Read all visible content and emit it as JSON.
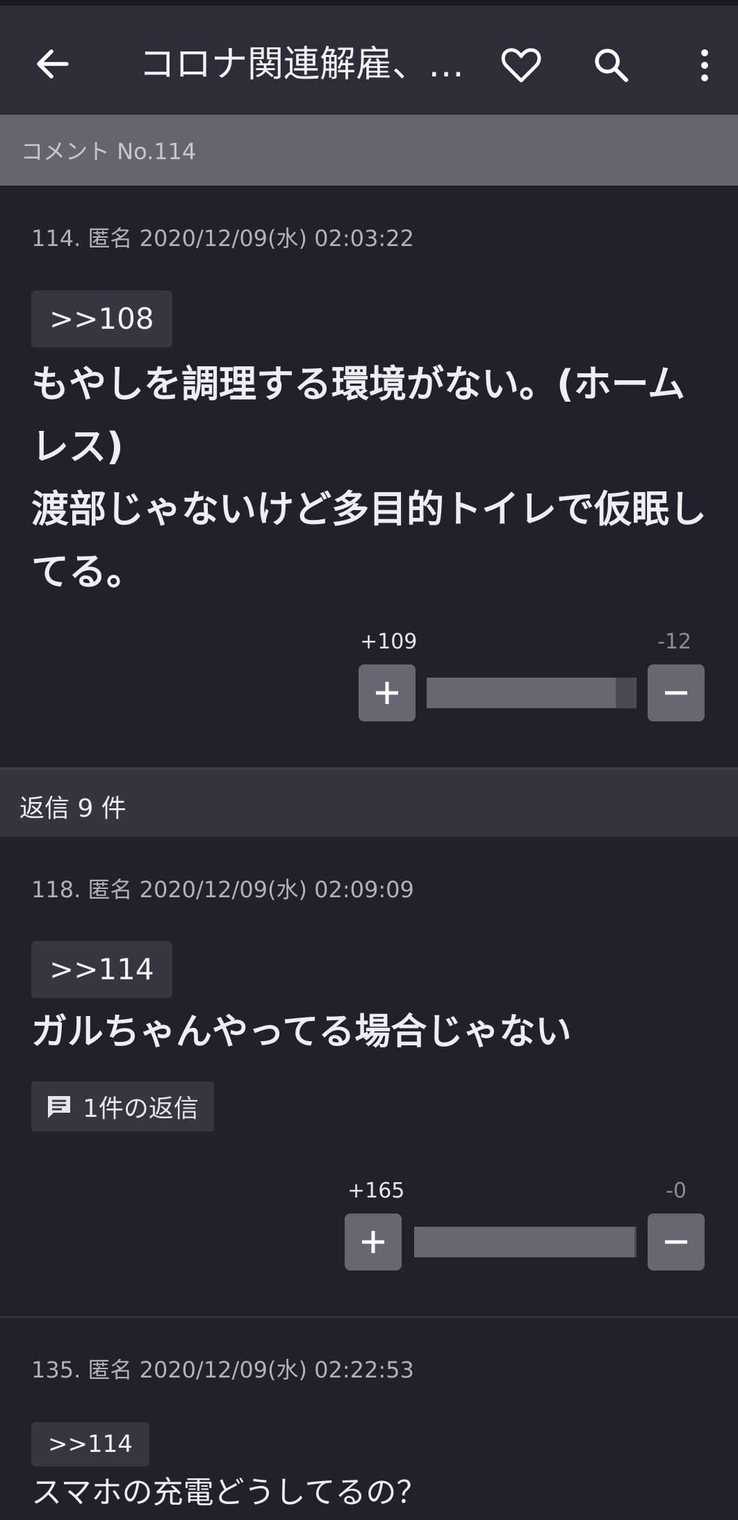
{
  "appbar": {
    "title": "コロナ関連解雇、…",
    "back_icon": "arrow-back-icon",
    "favorite_icon": "heart-outline-icon",
    "search_icon": "search-icon",
    "more_icon": "more-vert-icon"
  },
  "comment_bar": {
    "label": "コメント No.114"
  },
  "main_post": {
    "meta": "114. 匿名 2020/12/09(水) 02:03:22",
    "anchor": ">>108",
    "lines": [
      "もやしを調理する環境がない。(ホーム",
      "レス)",
      "渡部じゃないけど多目的トイレで仮眠し",
      "てる。"
    ],
    "plus": "+109",
    "minus": "-12",
    "plus_ratio": 0.9
  },
  "replies_header": {
    "label": "返信 9 件"
  },
  "replies": [
    {
      "meta": "118. 匿名 2020/12/09(水) 02:09:09",
      "anchor": ">>114",
      "text": "ガルちゃんやってる場合じゃない",
      "reply_count": "1件の返信",
      "plus": "+165",
      "minus": "-0",
      "plus_ratio": 0.99
    },
    {
      "meta": "135. 匿名 2020/12/09(水) 02:22:53",
      "anchor": ">>114",
      "text": "スマホの充電どうしてるの？"
    }
  ],
  "colors": {
    "background": "#22212b",
    "appbar": "#2d2c38",
    "number_bar": "#66656f",
    "vote_button": "#676672"
  }
}
